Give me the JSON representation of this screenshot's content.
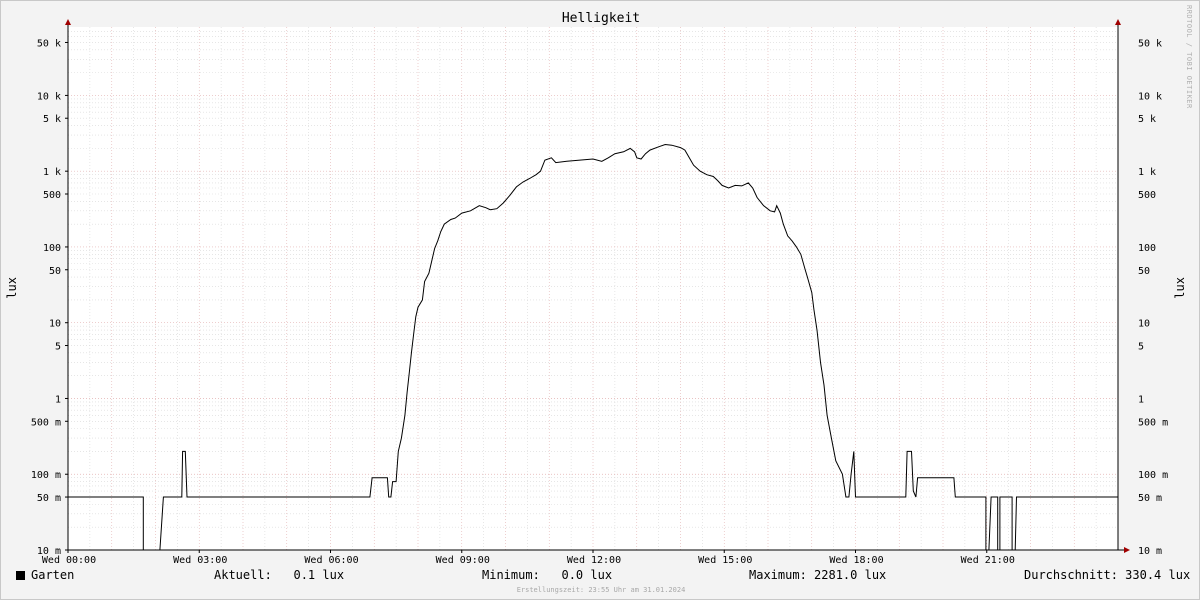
{
  "title": "Helligkeit",
  "watermark": "RRDTOOL / TOBI OETIKER",
  "footer": "Erstellungszeit: 23:55 Uhr am 31.01.2024",
  "legend": {
    "color": "#000000",
    "name": "Garten",
    "current": "Aktuell:   0.1 lux",
    "minimum": "Minimum:   0.0 lux",
    "maximum": "Maximum: 2281.0 lux",
    "average": "Durchschnitt: 330.4 lux"
  },
  "chart_data": {
    "type": "line",
    "title": "Helligkeit",
    "ylabel": "lux",
    "y_scale": "log",
    "ylim": [
      0.01,
      80000
    ],
    "xlim_hours": [
      0,
      24
    ],
    "grid": true,
    "x_ticks": [
      {
        "h": 0,
        "label": "Wed 00:00"
      },
      {
        "h": 3,
        "label": "Wed 03:00"
      },
      {
        "h": 6,
        "label": "Wed 06:00"
      },
      {
        "h": 9,
        "label": "Wed 09:00"
      },
      {
        "h": 12,
        "label": "Wed 12:00"
      },
      {
        "h": 15,
        "label": "Wed 15:00"
      },
      {
        "h": 18,
        "label": "Wed 18:00"
      },
      {
        "h": 21,
        "label": "Wed 21:00"
      }
    ],
    "y_ticks": [
      {
        "v": 0.01,
        "label": "10 m"
      },
      {
        "v": 0.05,
        "label": "50 m"
      },
      {
        "v": 0.1,
        "label": "100 m"
      },
      {
        "v": 0.5,
        "label": "500 m"
      },
      {
        "v": 1,
        "label": "1"
      },
      {
        "v": 5,
        "label": "5"
      },
      {
        "v": 10,
        "label": "10"
      },
      {
        "v": 50,
        "label": "50"
      },
      {
        "v": 100,
        "label": "100"
      },
      {
        "v": 500,
        "label": "500"
      },
      {
        "v": 1000,
        "label": "1 k"
      },
      {
        "v": 5000,
        "label": "5 k"
      },
      {
        "v": 10000,
        "label": "10 k"
      },
      {
        "v": 50000,
        "label": "50 k"
      }
    ],
    "series": [
      {
        "name": "Garten",
        "color": "#000000",
        "points": [
          [
            0.0,
            0.05
          ],
          [
            1.72,
            0.05
          ],
          [
            1.72,
            0.0
          ],
          [
            2.1,
            0.0
          ],
          [
            2.18,
            0.05
          ],
          [
            2.6,
            0.05
          ],
          [
            2.62,
            0.2
          ],
          [
            2.68,
            0.2
          ],
          [
            2.72,
            0.05
          ],
          [
            6.9,
            0.05
          ],
          [
            6.95,
            0.09
          ],
          [
            7.3,
            0.09
          ],
          [
            7.33,
            0.05
          ],
          [
            7.38,
            0.05
          ],
          [
            7.42,
            0.08
          ],
          [
            7.5,
            0.08
          ],
          [
            7.55,
            0.2
          ],
          [
            7.62,
            0.3
          ],
          [
            7.7,
            0.6
          ],
          [
            7.75,
            1.2
          ],
          [
            7.8,
            2.2
          ],
          [
            7.85,
            4
          ],
          [
            7.9,
            7
          ],
          [
            7.95,
            12
          ],
          [
            8.0,
            16
          ],
          [
            8.1,
            20
          ],
          [
            8.15,
            35
          ],
          [
            8.25,
            45
          ],
          [
            8.3,
            60
          ],
          [
            8.38,
            95
          ],
          [
            8.45,
            120
          ],
          [
            8.52,
            160
          ],
          [
            8.6,
            200
          ],
          [
            8.75,
            230
          ],
          [
            8.85,
            240
          ],
          [
            9.0,
            280
          ],
          [
            9.2,
            300
          ],
          [
            9.4,
            350
          ],
          [
            9.55,
            330
          ],
          [
            9.65,
            310
          ],
          [
            9.8,
            320
          ],
          [
            9.95,
            380
          ],
          [
            10.1,
            480
          ],
          [
            10.25,
            620
          ],
          [
            10.4,
            720
          ],
          [
            10.55,
            800
          ],
          [
            10.7,
            900
          ],
          [
            10.8,
            1000
          ],
          [
            10.9,
            1400
          ],
          [
            11.05,
            1500
          ],
          [
            11.15,
            1300
          ],
          [
            11.4,
            1350
          ],
          [
            11.7,
            1400
          ],
          [
            12.0,
            1450
          ],
          [
            12.2,
            1350
          ],
          [
            12.35,
            1500
          ],
          [
            12.5,
            1700
          ],
          [
            12.7,
            1800
          ],
          [
            12.85,
            2000
          ],
          [
            12.95,
            1800
          ],
          [
            13.0,
            1500
          ],
          [
            13.1,
            1450
          ],
          [
            13.2,
            1700
          ],
          [
            13.3,
            1900
          ],
          [
            13.5,
            2100
          ],
          [
            13.65,
            2250
          ],
          [
            13.8,
            2200
          ],
          [
            14.0,
            2050
          ],
          [
            14.1,
            1900
          ],
          [
            14.2,
            1500
          ],
          [
            14.3,
            1200
          ],
          [
            14.45,
            1000
          ],
          [
            14.6,
            900
          ],
          [
            14.75,
            850
          ],
          [
            14.85,
            750
          ],
          [
            14.95,
            650
          ],
          [
            15.1,
            600
          ],
          [
            15.25,
            650
          ],
          [
            15.4,
            640
          ],
          [
            15.55,
            700
          ],
          [
            15.65,
            600
          ],
          [
            15.75,
            450
          ],
          [
            15.9,
            350
          ],
          [
            16.05,
            300
          ],
          [
            16.15,
            290
          ],
          [
            16.2,
            350
          ],
          [
            16.28,
            280
          ],
          [
            16.35,
            200
          ],
          [
            16.45,
            140
          ],
          [
            16.55,
            120
          ],
          [
            16.65,
            100
          ],
          [
            16.75,
            80
          ],
          [
            16.85,
            50
          ],
          [
            16.9,
            40
          ],
          [
            17.0,
            25
          ],
          [
            17.05,
            15
          ],
          [
            17.12,
            8
          ],
          [
            17.2,
            3
          ],
          [
            17.28,
            1.5
          ],
          [
            17.35,
            0.6
          ],
          [
            17.45,
            0.3
          ],
          [
            17.55,
            0.15
          ],
          [
            17.7,
            0.1
          ],
          [
            17.78,
            0.05
          ],
          [
            17.85,
            0.05
          ],
          [
            17.9,
            0.1
          ],
          [
            17.96,
            0.2
          ],
          [
            18.0,
            0.05
          ],
          [
            19.15,
            0.05
          ],
          [
            19.18,
            0.2
          ],
          [
            19.28,
            0.2
          ],
          [
            19.32,
            0.06
          ],
          [
            19.38,
            0.05
          ],
          [
            19.42,
            0.09
          ],
          [
            20.25,
            0.09
          ],
          [
            20.28,
            0.05
          ],
          [
            20.98,
            0.05
          ],
          [
            20.98,
            0.0
          ],
          [
            21.05,
            0.0
          ],
          [
            21.1,
            0.05
          ],
          [
            21.25,
            0.05
          ],
          [
            21.25,
            0.0
          ],
          [
            21.3,
            0.0
          ],
          [
            21.3,
            0.05
          ],
          [
            21.58,
            0.05
          ],
          [
            21.58,
            0.0
          ],
          [
            21.65,
            0.0
          ],
          [
            21.68,
            0.05
          ],
          [
            24.0,
            0.05
          ]
        ]
      }
    ]
  }
}
